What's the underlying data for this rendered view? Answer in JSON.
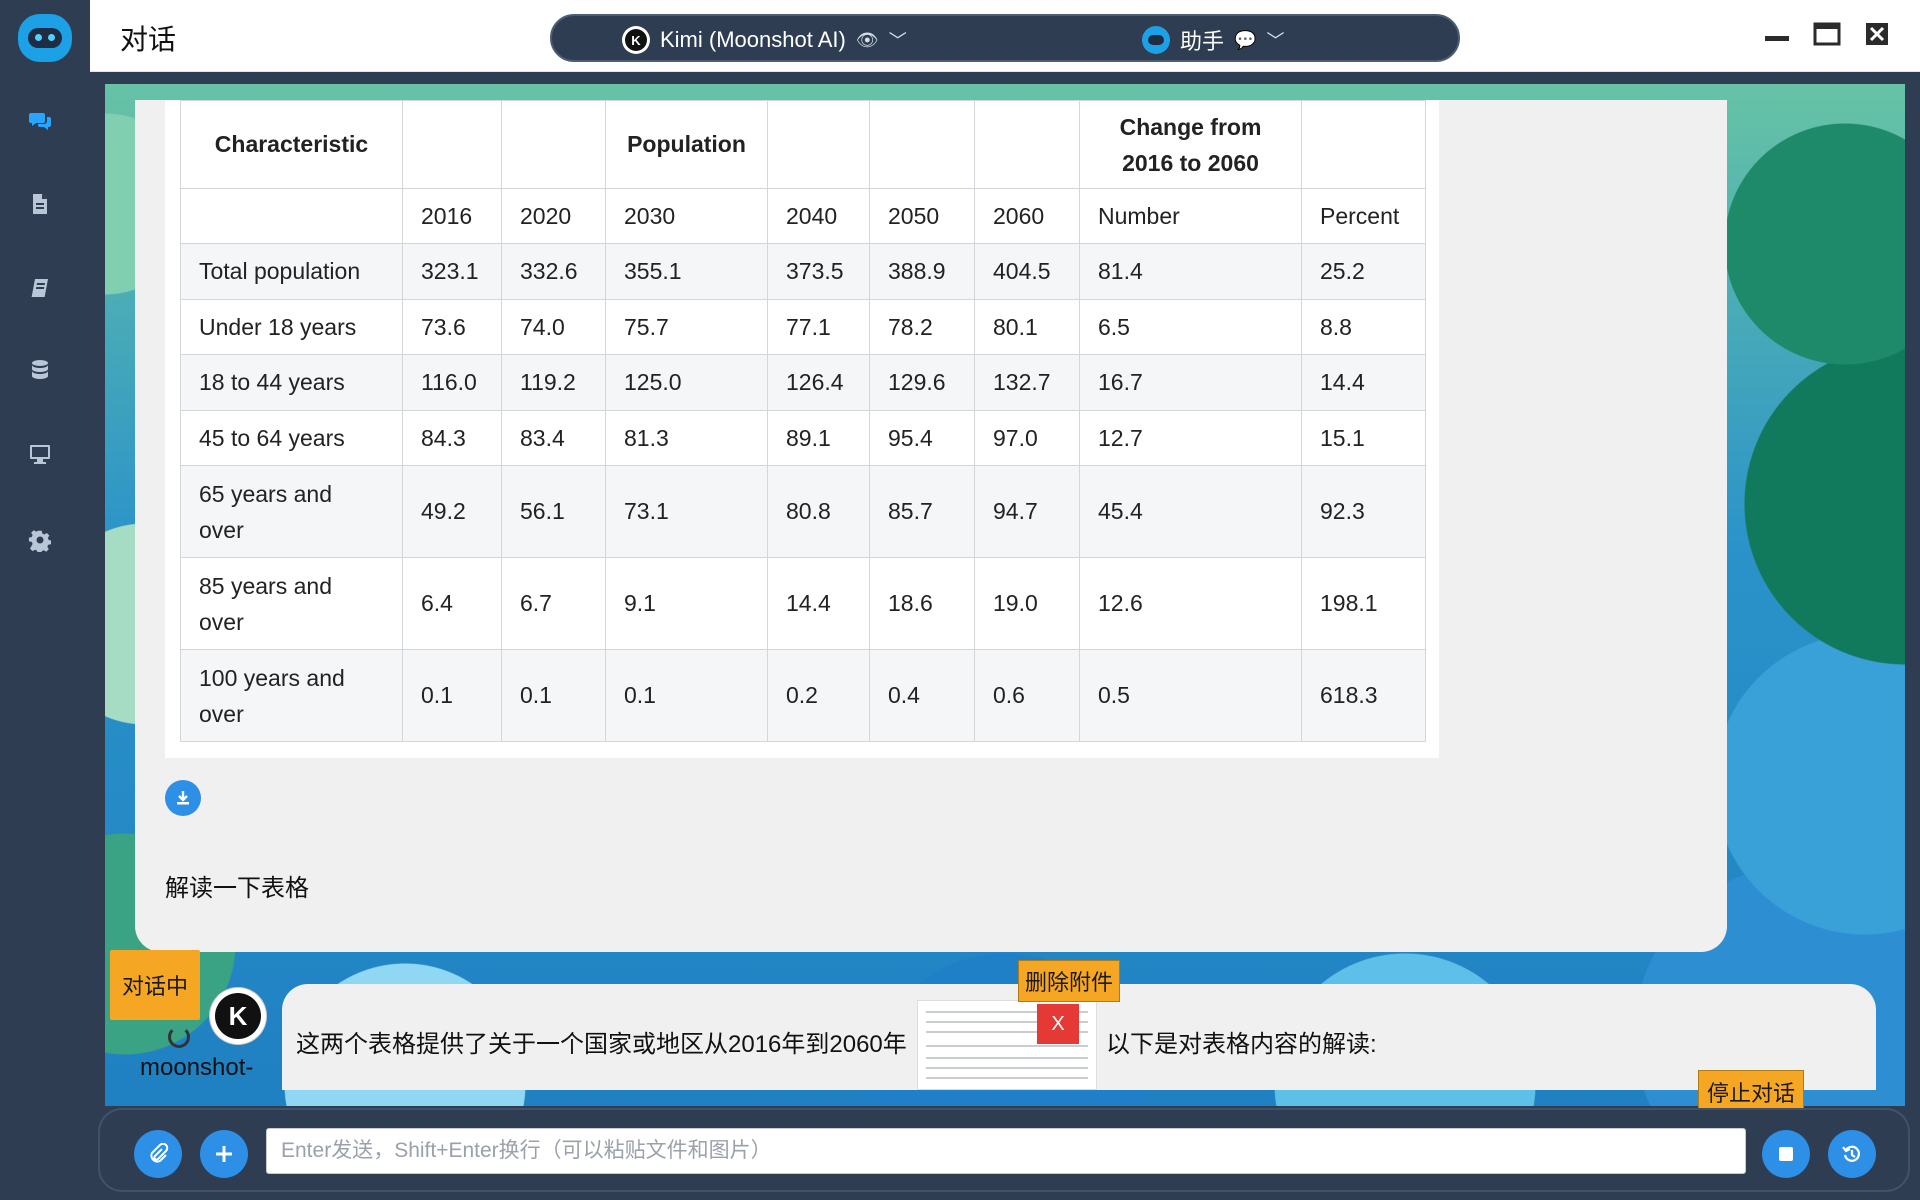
{
  "header": {
    "title": "对话",
    "model_name": "Kimi (Moonshot AI)",
    "model_badge": "K",
    "assistant_name": "助手"
  },
  "sidebar": {
    "items": [
      {
        "icon": "chat-icon",
        "active": true
      },
      {
        "icon": "document-icon",
        "active": false
      },
      {
        "icon": "notebook-icon",
        "active": false
      },
      {
        "icon": "database-icon",
        "active": false
      },
      {
        "icon": "monitor-icon",
        "active": false
      },
      {
        "icon": "gear-icon",
        "active": false
      }
    ]
  },
  "table": {
    "header_row1": {
      "characteristic": "Characteristic",
      "population": "Population",
      "change_line1": "Change from",
      "change_line2": "2016 to 2060"
    },
    "header_row2": [
      "2016",
      "2020",
      "2030",
      "2040",
      "2050",
      "2060",
      "Number",
      "Percent"
    ],
    "rows": [
      {
        "label": "Total population",
        "values": [
          "323.1",
          "332.6",
          "355.1",
          "373.5",
          "388.9",
          "404.5",
          "81.4",
          "25.2"
        ]
      },
      {
        "label": "Under 18 years",
        "values": [
          "73.6",
          "74.0",
          "75.7",
          "77.1",
          "78.2",
          "80.1",
          "6.5",
          "8.8"
        ]
      },
      {
        "label": "18 to 44 years",
        "values": [
          "116.0",
          "119.2",
          "125.0",
          "126.4",
          "129.6",
          "132.7",
          "16.7",
          "14.4"
        ]
      },
      {
        "label": "45 to 64 years",
        "values": [
          "84.3",
          "83.4",
          "81.3",
          "89.1",
          "95.4",
          "97.0",
          "12.7",
          "15.1"
        ]
      },
      {
        "label_line1": "65 years and",
        "label_line2": "over",
        "values": [
          "49.2",
          "56.1",
          "73.1",
          "80.8",
          "85.7",
          "94.7",
          "45.4",
          "92.3"
        ]
      },
      {
        "label_line1": "85 years and",
        "label_line2": "over",
        "values": [
          "6.4",
          "6.7",
          "9.1",
          "14.4",
          "18.6",
          "19.0",
          "12.6",
          "198.1"
        ]
      },
      {
        "label_line1": "100 years and",
        "label_line2": "over",
        "values": [
          "0.1",
          "0.1",
          "0.1",
          "0.2",
          "0.4",
          "0.6",
          "0.5",
          "618.3"
        ]
      }
    ]
  },
  "user_message": {
    "text": "解读一下表格"
  },
  "status": {
    "label": "对话中"
  },
  "assistant_message": {
    "name": "moonshot-",
    "badge": "K",
    "text_before": "这两个表格提供了关于一个国家或地区从2016年到2060年",
    "text_after": "以下是对表格内容的解读:",
    "attachment_tooltip": "删除附件",
    "attachment_delete_label": "X"
  },
  "stop_tooltip": "停止对话",
  "input": {
    "placeholder": "Enter发送，Shift+Enter换行（可以粘贴文件和图片）",
    "value": ""
  },
  "colors": {
    "accent": "#2d8fe6",
    "sidebar": "#2f3d52",
    "warning": "#f5a623",
    "danger": "#e53935"
  }
}
